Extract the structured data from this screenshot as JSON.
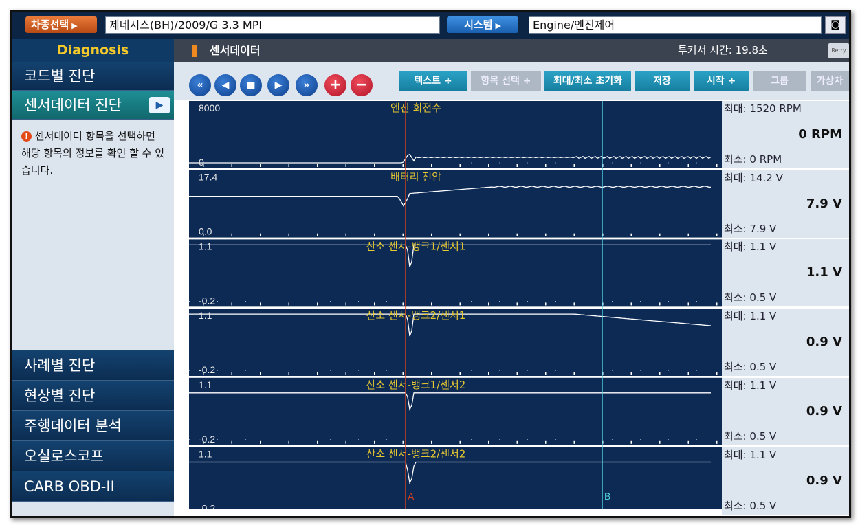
{
  "topbar": {
    "vehicle_label": "차종선택",
    "vehicle_value": "제네시스(BH)/2009/G 3.3 MPI",
    "system_label": "시스템",
    "system_value": "Engine/엔진제어",
    "camera_icon": "camera-icon"
  },
  "sidebar": {
    "header": "Diagnosis",
    "items_top": [
      {
        "label": "코드별 진단"
      },
      {
        "label": "센서데이터 진단",
        "active": true
      }
    ],
    "info_text": "센서데이터 항목을 선택하면 해당 항목의 정보를 확인 할 수 있습니다.",
    "items_bottom": [
      {
        "label": "사례별 진단"
      },
      {
        "label": "현상별 진단"
      },
      {
        "label": "주행데이터 분석"
      },
      {
        "label": "오실로스코프"
      },
      {
        "label": "CARB OBD-II"
      }
    ]
  },
  "panel": {
    "title": "센서데이터",
    "capture_time": "투커서 시간: 19.8초",
    "retry_label": "Retry"
  },
  "toolbar": {
    "text_btn": "텍스트 ÷",
    "item_select_btn": "항목 선택 ÷",
    "reset_btn": "최대/최소 초기화",
    "save_btn": "저장",
    "start_btn": "시작 ÷",
    "group_btn": "그룹",
    "virtual_btn": "가상차"
  },
  "chart_data": {
    "type": "line",
    "cursors": [
      {
        "name": "A",
        "color": "#e0401a"
      },
      {
        "name": "B",
        "color": "#52d4e0"
      }
    ],
    "series": [
      {
        "name": "엔진 회전수",
        "ymax_label": "8000",
        "ymin_label": "0",
        "max": "1520 RPM",
        "current": "0 RPM",
        "min": "0 RPM"
      },
      {
        "name": "배터리 전압",
        "ymax_label": "17.4",
        "ymin_label": "0.0",
        "max": "14.2 V",
        "current": "7.9 V",
        "min": "7.9 V"
      },
      {
        "name": "산소 센서-뱅크1/센서1",
        "ymax_label": "1.1",
        "ymin_label": "-0.2",
        "max": "1.1 V",
        "current": "1.1 V",
        "min": "0.5 V"
      },
      {
        "name": "산소 센서-뱅크2/센서1",
        "ymax_label": "1.1",
        "ymin_label": "-0.2",
        "max": "1.1 V",
        "current": "0.9 V",
        "min": "0.5 V"
      },
      {
        "name": "산소 센서-뱅크1/센서2",
        "ymax_label": "1.1",
        "ymin_label": "-0.2",
        "max": "1.1 V",
        "current": "0.9 V",
        "min": "0.5 V"
      },
      {
        "name": "산소 센서-뱅크2/센서2",
        "ymax_label": "1.1",
        "ymin_label": "-0.2",
        "max": "1.1 V",
        "current": "0.9 V",
        "min": "0.5 V"
      }
    ],
    "max_prefix": "최대:",
    "min_prefix": "최소:"
  }
}
